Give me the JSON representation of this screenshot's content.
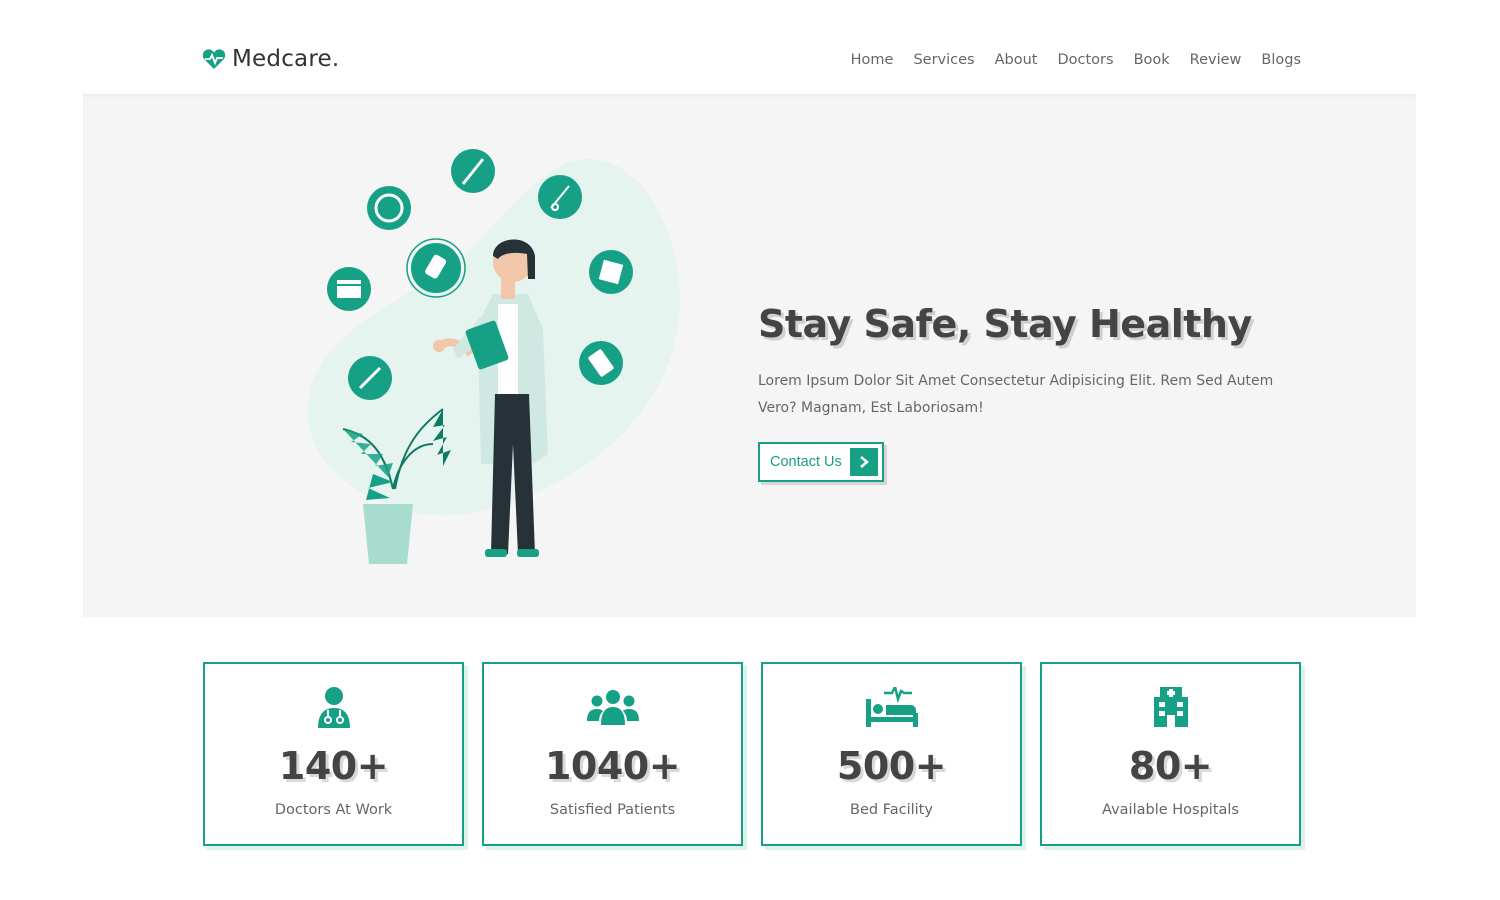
{
  "header": {
    "logo_text": "Medcare.",
    "logo_icon": "heartbeat-icon",
    "nav": [
      "Home",
      "Services",
      "About",
      "Doctors",
      "Book",
      "Review",
      "Blogs"
    ]
  },
  "hero": {
    "title": "Stay Safe, Stay Healthy",
    "description": "Lorem Ipsum Dolor Sit Amet Consectetur Adipisicing Elit. Rem Sed Autem Vero? Magnam, Est Laboriosam!",
    "button_label": "Contact Us",
    "illustration": "doctor-with-medical-icons-illustration"
  },
  "stats": [
    {
      "icon": "user-doctor-icon",
      "number": "140+",
      "label": "Doctors At Work"
    },
    {
      "icon": "users-icon",
      "number": "1040+",
      "label": "Satisfied Patients"
    },
    {
      "icon": "procedures-bed-icon",
      "number": "500+",
      "label": "Bed Facility"
    },
    {
      "icon": "hospital-icon",
      "number": "80+",
      "label": "Available Hospitals"
    }
  ],
  "colors": {
    "accent": "#16a085",
    "hero_bg": "#f5f5f5",
    "text": "#444444"
  }
}
